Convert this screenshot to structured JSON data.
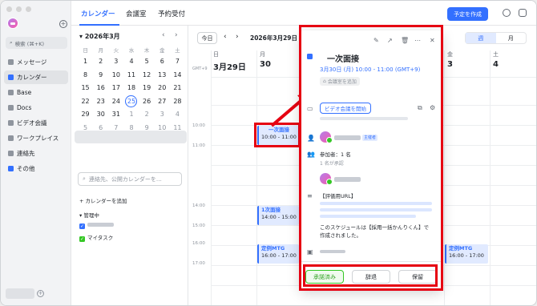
{
  "nav": {
    "search_label": "検索 (⌘+K)",
    "items": [
      {
        "label": "メッセージ"
      },
      {
        "label": "カレンダー"
      },
      {
        "label": "Base"
      },
      {
        "label": "Docs"
      },
      {
        "label": "ビデオ会議"
      },
      {
        "label": "ワークプレイス"
      },
      {
        "label": "連絡先"
      },
      {
        "label": "その他"
      }
    ]
  },
  "tabs": [
    "カレンダー",
    "会議室",
    "予約受付"
  ],
  "toolbar": {
    "create_label": "予定を作成",
    "today_label": "今日",
    "range": "2026年3月29日 - 4",
    "views": [
      "週",
      "月"
    ]
  },
  "mini_calendar": {
    "month": "2026年3月",
    "weekdays": [
      "日",
      "月",
      "火",
      "水",
      "木",
      "金",
      "土"
    ],
    "rows": [
      [
        "1",
        "2",
        "3",
        "4",
        "5",
        "6",
        "7"
      ],
      [
        "8",
        "9",
        "10",
        "11",
        "12",
        "13",
        "14"
      ],
      [
        "15",
        "16",
        "17",
        "18",
        "19",
        "20",
        "21"
      ],
      [
        "22",
        "23",
        "24",
        "25",
        "26",
        "27",
        "28"
      ],
      [
        "29",
        "30",
        "31",
        "1",
        "2",
        "3",
        "4"
      ],
      [
        "5",
        "6",
        "7",
        "8",
        "9",
        "10",
        "11"
      ]
    ],
    "today": "25"
  },
  "calendar_search_placeholder": "連絡先、公開カレンダーを…",
  "sections": {
    "add": "カレンダーを追加",
    "managed": "管理中",
    "my_task": "マイタスク"
  },
  "days": [
    {
      "dow": "日",
      "date": "3月29日"
    },
    {
      "dow": "月",
      "date": "30"
    },
    {
      "dow": "金",
      "date": "3"
    },
    {
      "dow": "土",
      "date": "4"
    }
  ],
  "gmt": "GMT+9",
  "hours": [
    "10:00",
    "11:00",
    "14:00",
    "15:00",
    "16:00",
    "17:00"
  ],
  "events": [
    {
      "title": "一次面接",
      "time": "10:00 - 11:00"
    },
    {
      "title": "1次面接",
      "time": "14:00 - 15:00"
    },
    {
      "title": "定例MTG",
      "time": "16:00 - 17:00"
    },
    {
      "title": "定例MTG",
      "time": "16:00 - 17:00"
    }
  ],
  "popup": {
    "title": "一次面接",
    "time": "3月30日 (月) 10:00 - 11:00 (GMT+9)",
    "room_label": "会議室を追加",
    "video_label": "ビデオ会議を開始",
    "host_badge": "主催者",
    "attendees": "参加者：1 名",
    "accepted": "1 名が承認",
    "desc_label": "【評価用URL】",
    "desc_note": "このスケジュールは【採用一括かんりくん】で作成されました。",
    "buttons": {
      "accept": "承諾済み",
      "decline": "辞退",
      "tentative": "保留"
    }
  },
  "colors": {
    "accent": "#3370ff",
    "highlight": "#e60012"
  }
}
